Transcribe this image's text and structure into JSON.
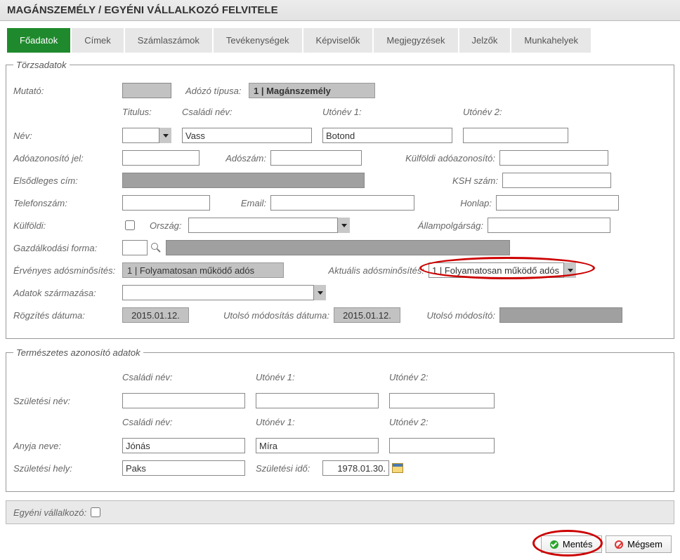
{
  "title": "MAGÁNSZEMÉLY / EGYÉNI VÁLLALKOZÓ FELVITELE",
  "tabs": [
    {
      "label": "Főadatok",
      "active": true
    },
    {
      "label": "Címek"
    },
    {
      "label": "Számlaszámok"
    },
    {
      "label": "Tevékenységek"
    },
    {
      "label": "Képviselők"
    },
    {
      "label": "Megjegyzések"
    },
    {
      "label": "Jelzők"
    },
    {
      "label": "Munkahelyek"
    }
  ],
  "fs1": {
    "legend": "Törzsadatok",
    "mutato_label": "Mutató:",
    "adozo_tipusa_label": "Adózó típusa:",
    "adozo_tipusa_value": "1 | Magánszemély",
    "titulus_hdr": "Titulus:",
    "csaladi_hdr": "Családi név:",
    "utonev1_hdr": "Utónév 1:",
    "utonev2_hdr": "Utónév 2:",
    "nev_label": "Név:",
    "csaladi_val": "Vass",
    "utonev1_val": "Botond",
    "adoazonosito_label": "Adóazonosító jel:",
    "adoszam_label": "Adószám:",
    "kulfoldi_ado_label": "Külföldi adóazonosító:",
    "elsodleges_cim_label": "Elsődleges cím:",
    "ksh_label": "KSH szám:",
    "telefon_label": "Telefonszám:",
    "email_label": "Email:",
    "honlap_label": "Honlap:",
    "kulfoldi_label": "Külföldi:",
    "orszag_label": "Ország:",
    "allampolg_label": "Állampolgárság:",
    "gazd_label": "Gazdálkodási forma:",
    "erv_adosmin_label": "Érvényes adósminősítés:",
    "erv_adosmin_value": "1 | Folyamatosan működő adós",
    "akt_adosmin_label": "Aktuális adósminősítés:",
    "akt_adosmin_value": "1 | Folyamatosan működő adós",
    "adatok_szarm_label": "Adatok származása:",
    "rogzites_label": "Rögzítés dátuma:",
    "rogzites_value": "2015.01.12.",
    "utolso_mod_datum_label": "Utolsó módosítás dátuma:",
    "utolso_mod_datum_value": "2015.01.12.",
    "utolso_mod_label": "Utolsó módosító:"
  },
  "fs2": {
    "legend": "Természetes azonosító adatok",
    "csaladi_hdr": "Családi név:",
    "utonev1_hdr": "Utónév 1:",
    "utonev2_hdr": "Utónév 2:",
    "szul_nev_label": "Születési név:",
    "anyja_label": "Anyja neve:",
    "anyja_csaladi": "Jónás",
    "anyja_utonev1": "Míra",
    "szul_hely_label": "Születési hely:",
    "szul_hely_val": "Paks",
    "szul_ido_label": "Születési idő:",
    "szul_ido_val": "1978.01.30."
  },
  "footer": {
    "egyeni_label": "Egyéni vállalkozó:"
  },
  "buttons": {
    "save": "Mentés",
    "cancel": "Mégsem"
  }
}
